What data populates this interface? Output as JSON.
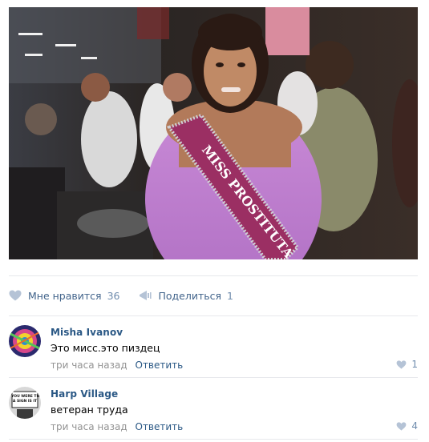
{
  "post": {
    "photo": {
      "sash_text": "MISS PROSTITUTA"
    },
    "actions": {
      "like_label": "Мне нравится",
      "like_count": "36",
      "share_label": "Поделиться",
      "share_count": "1"
    }
  },
  "comments": [
    {
      "author": "Misha Ivanov",
      "text": "Это мисс.это пиздец",
      "time": "три часа назад",
      "reply_label": "Ответить",
      "likes": "1"
    },
    {
      "author": "Harp Village",
      "text": "ветеран труда",
      "time": "три часа назад",
      "reply_label": "Ответить",
      "likes": "4",
      "avatar_text": "IF YOU WERE THIS A SIGN IS IT"
    }
  ],
  "colors": {
    "link": "#2a5885",
    "action": "#42648b",
    "muted": "#939393",
    "divider": "#e7e8ec"
  },
  "icons": [
    "heart-icon",
    "share-icon"
  ]
}
